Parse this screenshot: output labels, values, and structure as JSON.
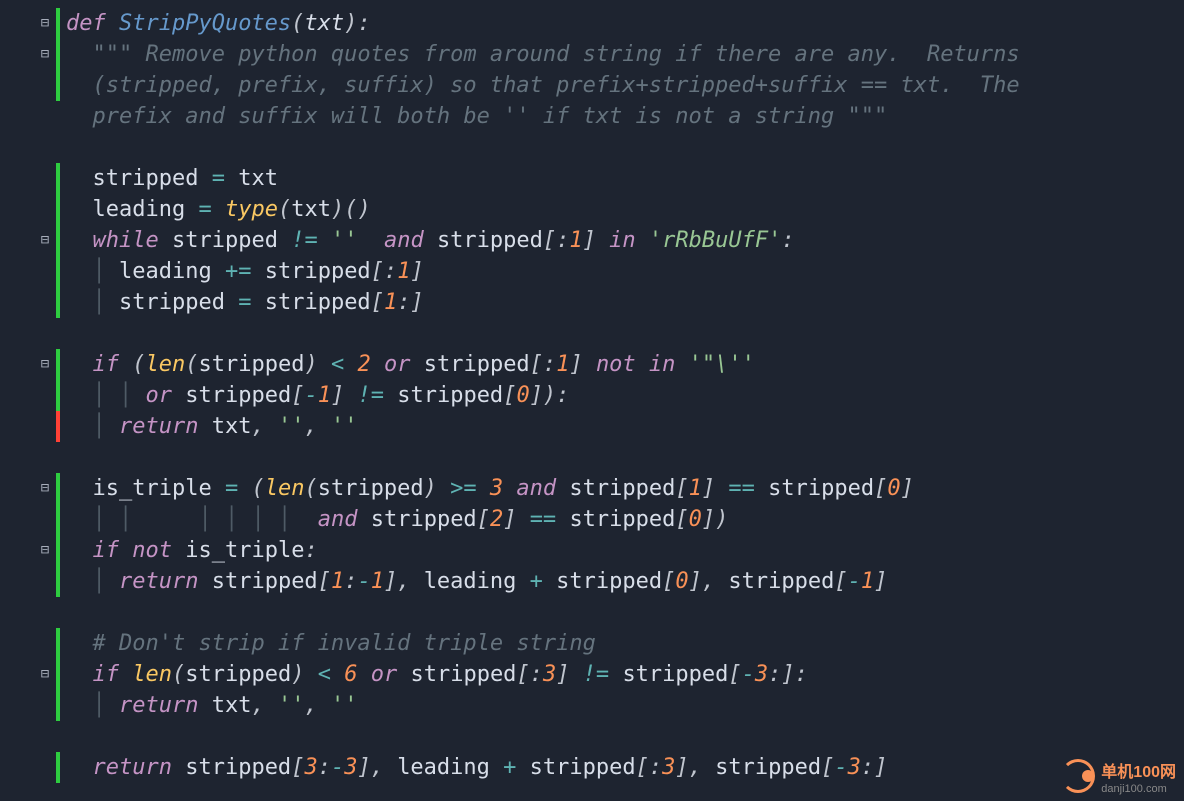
{
  "lines": [
    {
      "indent": 0,
      "type": "code",
      "tokens": [
        {
          "c": "kw",
          "t": "def "
        },
        {
          "c": "fn",
          "t": "StripPyQuotes"
        },
        {
          "c": "punct",
          "t": "("
        },
        {
          "c": "param",
          "t": "txt"
        },
        {
          "c": "punct",
          "t": "):"
        }
      ],
      "fold": true,
      "diff": "green",
      "diffH": 1
    },
    {
      "indent": 1,
      "type": "code",
      "tokens": [
        {
          "c": "docstr",
          "t": "\"\"\" Remove python quotes from around string if there are any.  Returns"
        }
      ],
      "fold": true,
      "diff": "green",
      "diffH": 2
    },
    {
      "indent": 1,
      "type": "code",
      "tokens": [
        {
          "c": "docstr",
          "t": "(stripped, prefix, suffix) so that prefix+stripped+suffix == txt.  The"
        }
      ]
    },
    {
      "indent": 1,
      "type": "code",
      "tokens": [
        {
          "c": "docstr",
          "t": "prefix and suffix will both be '' if txt is not a string \"\"\""
        }
      ]
    },
    {
      "indent": 0,
      "type": "blank"
    },
    {
      "indent": 1,
      "type": "code",
      "tokens": [
        {
          "c": "ident",
          "t": "stripped "
        },
        {
          "c": "op",
          "t": "= "
        },
        {
          "c": "ident",
          "t": "txt"
        }
      ],
      "diff": "green",
      "diffH": 5
    },
    {
      "indent": 1,
      "type": "code",
      "tokens": [
        {
          "c": "ident",
          "t": "leading "
        },
        {
          "c": "op",
          "t": "= "
        },
        {
          "c": "builtin",
          "t": "type"
        },
        {
          "c": "punct",
          "t": "("
        },
        {
          "c": "ident",
          "t": "txt"
        },
        {
          "c": "punct",
          "t": ")()"
        }
      ]
    },
    {
      "indent": 1,
      "type": "code",
      "tokens": [
        {
          "c": "kw",
          "t": "while "
        },
        {
          "c": "ident",
          "t": "stripped "
        },
        {
          "c": "op",
          "t": "!= "
        },
        {
          "c": "str",
          "t": "''"
        },
        {
          "c": "ident",
          "t": " "
        },
        {
          "c": "kw",
          "t": " and "
        },
        {
          "c": "ident",
          "t": "stripped"
        },
        {
          "c": "punct",
          "t": "[:"
        },
        {
          "c": "num",
          "t": "1"
        },
        {
          "c": "punct",
          "t": "]"
        },
        {
          "c": "ident",
          "t": " "
        },
        {
          "c": "kw",
          "t": "in "
        },
        {
          "c": "str",
          "t": "'rRbBuUfF'"
        },
        {
          "c": "punct",
          "t": ":"
        }
      ],
      "fold": true
    },
    {
      "indent": 2,
      "type": "code",
      "tokens": [
        {
          "c": "ident",
          "t": "leading "
        },
        {
          "c": "op",
          "t": "+= "
        },
        {
          "c": "ident",
          "t": "stripped"
        },
        {
          "c": "punct",
          "t": "[:"
        },
        {
          "c": "num",
          "t": "1"
        },
        {
          "c": "punct",
          "t": "]"
        }
      ]
    },
    {
      "indent": 2,
      "type": "code",
      "tokens": [
        {
          "c": "ident",
          "t": "stripped "
        },
        {
          "c": "op",
          "t": "= "
        },
        {
          "c": "ident",
          "t": "stripped"
        },
        {
          "c": "punct",
          "t": "["
        },
        {
          "c": "num",
          "t": "1"
        },
        {
          "c": "punct",
          "t": ":]"
        }
      ]
    },
    {
      "indent": 0,
      "type": "blank"
    },
    {
      "indent": 1,
      "type": "code",
      "tokens": [
        {
          "c": "kw",
          "t": "if "
        },
        {
          "c": "punct",
          "t": "("
        },
        {
          "c": "builtin",
          "t": "len"
        },
        {
          "c": "punct",
          "t": "("
        },
        {
          "c": "ident",
          "t": "stripped"
        },
        {
          "c": "punct",
          "t": ") "
        },
        {
          "c": "op",
          "t": "< "
        },
        {
          "c": "num",
          "t": "2"
        },
        {
          "c": "ident",
          "t": " "
        },
        {
          "c": "kw",
          "t": "or "
        },
        {
          "c": "ident",
          "t": "stripped"
        },
        {
          "c": "punct",
          "t": "[:"
        },
        {
          "c": "num",
          "t": "1"
        },
        {
          "c": "punct",
          "t": "]"
        },
        {
          "c": "ident",
          "t": " "
        },
        {
          "c": "kw",
          "t": "not in "
        },
        {
          "c": "str",
          "t": "'\"\\''"
        }
      ],
      "fold": true,
      "diff": "green",
      "diffH": 2
    },
    {
      "indent": 3,
      "type": "code",
      "tokens": [
        {
          "c": "kw",
          "t": "or "
        },
        {
          "c": "ident",
          "t": "stripped"
        },
        {
          "c": "punct",
          "t": "["
        },
        {
          "c": "op",
          "t": "-"
        },
        {
          "c": "num",
          "t": "1"
        },
        {
          "c": "punct",
          "t": "] "
        },
        {
          "c": "op",
          "t": "!= "
        },
        {
          "c": "ident",
          "t": "stripped"
        },
        {
          "c": "punct",
          "t": "["
        },
        {
          "c": "num",
          "t": "0"
        },
        {
          "c": "punct",
          "t": "]):"
        }
      ]
    },
    {
      "indent": 2,
      "type": "code",
      "tokens": [
        {
          "c": "kw",
          "t": "return "
        },
        {
          "c": "ident",
          "t": "txt"
        },
        {
          "c": "punct",
          "t": ", "
        },
        {
          "c": "str",
          "t": "''"
        },
        {
          "c": "punct",
          "t": ", "
        },
        {
          "c": "str",
          "t": "''"
        }
      ],
      "diff": "red",
      "diffH": 1
    },
    {
      "indent": 0,
      "type": "blank"
    },
    {
      "indent": 1,
      "type": "code",
      "tokens": [
        {
          "c": "ident",
          "t": "is_triple "
        },
        {
          "c": "op",
          "t": "= "
        },
        {
          "c": "punct",
          "t": "("
        },
        {
          "c": "builtin",
          "t": "len"
        },
        {
          "c": "punct",
          "t": "("
        },
        {
          "c": "ident",
          "t": "stripped"
        },
        {
          "c": "punct",
          "t": ") "
        },
        {
          "c": "op",
          "t": ">= "
        },
        {
          "c": "num",
          "t": "3"
        },
        {
          "c": "ident",
          "t": " "
        },
        {
          "c": "kw",
          "t": "and "
        },
        {
          "c": "ident",
          "t": "stripped"
        },
        {
          "c": "punct",
          "t": "["
        },
        {
          "c": "num",
          "t": "1"
        },
        {
          "c": "punct",
          "t": "] "
        },
        {
          "c": "op",
          "t": "== "
        },
        {
          "c": "ident",
          "t": "stripped"
        },
        {
          "c": "punct",
          "t": "["
        },
        {
          "c": "num",
          "t": "0"
        },
        {
          "c": "punct",
          "t": "]"
        }
      ],
      "fold": true,
      "diff": "green",
      "diffH": 4
    },
    {
      "indent": 6,
      "type": "code",
      "tokens": [
        {
          "c": "ident",
          "t": " "
        },
        {
          "c": "kw",
          "t": "and "
        },
        {
          "c": "ident",
          "t": "stripped"
        },
        {
          "c": "punct",
          "t": "["
        },
        {
          "c": "num",
          "t": "2"
        },
        {
          "c": "punct",
          "t": "] "
        },
        {
          "c": "op",
          "t": "== "
        },
        {
          "c": "ident",
          "t": "stripped"
        },
        {
          "c": "punct",
          "t": "["
        },
        {
          "c": "num",
          "t": "0"
        },
        {
          "c": "punct",
          "t": "])"
        }
      ]
    },
    {
      "indent": 1,
      "type": "code",
      "tokens": [
        {
          "c": "kw",
          "t": "if "
        },
        {
          "c": "kw",
          "t": "not "
        },
        {
          "c": "ident",
          "t": "is_triple"
        },
        {
          "c": "punct",
          "t": ":"
        }
      ],
      "fold": true
    },
    {
      "indent": 2,
      "type": "code",
      "tokens": [
        {
          "c": "kw",
          "t": "return "
        },
        {
          "c": "ident",
          "t": "stripped"
        },
        {
          "c": "punct",
          "t": "["
        },
        {
          "c": "num",
          "t": "1"
        },
        {
          "c": "punct",
          "t": ":"
        },
        {
          "c": "op",
          "t": "-"
        },
        {
          "c": "num",
          "t": "1"
        },
        {
          "c": "punct",
          "t": "], "
        },
        {
          "c": "ident",
          "t": "leading "
        },
        {
          "c": "op",
          "t": "+ "
        },
        {
          "c": "ident",
          "t": "stripped"
        },
        {
          "c": "punct",
          "t": "["
        },
        {
          "c": "num",
          "t": "0"
        },
        {
          "c": "punct",
          "t": "], "
        },
        {
          "c": "ident",
          "t": "stripped"
        },
        {
          "c": "punct",
          "t": "["
        },
        {
          "c": "op",
          "t": "-"
        },
        {
          "c": "num",
          "t": "1"
        },
        {
          "c": "punct",
          "t": "]"
        }
      ]
    },
    {
      "indent": 0,
      "type": "blank"
    },
    {
      "indent": 1,
      "type": "code",
      "tokens": [
        {
          "c": "comment",
          "t": "# Don't strip if invalid triple string"
        }
      ],
      "diff": "green",
      "diffH": 3
    },
    {
      "indent": 1,
      "type": "code",
      "tokens": [
        {
          "c": "kw",
          "t": "if "
        },
        {
          "c": "builtin",
          "t": "len"
        },
        {
          "c": "punct",
          "t": "("
        },
        {
          "c": "ident",
          "t": "stripped"
        },
        {
          "c": "punct",
          "t": ") "
        },
        {
          "c": "op",
          "t": "< "
        },
        {
          "c": "num",
          "t": "6"
        },
        {
          "c": "ident",
          "t": " "
        },
        {
          "c": "kw",
          "t": "or "
        },
        {
          "c": "ident",
          "t": "stripped"
        },
        {
          "c": "punct",
          "t": "[:"
        },
        {
          "c": "num",
          "t": "3"
        },
        {
          "c": "punct",
          "t": "] "
        },
        {
          "c": "op",
          "t": "!= "
        },
        {
          "c": "ident",
          "t": "stripped"
        },
        {
          "c": "punct",
          "t": "["
        },
        {
          "c": "op",
          "t": "-"
        },
        {
          "c": "num",
          "t": "3"
        },
        {
          "c": "punct",
          "t": ":]:"
        }
      ],
      "fold": true
    },
    {
      "indent": 2,
      "type": "code",
      "tokens": [
        {
          "c": "kw",
          "t": "return "
        },
        {
          "c": "ident",
          "t": "txt"
        },
        {
          "c": "punct",
          "t": ", "
        },
        {
          "c": "str",
          "t": "''"
        },
        {
          "c": "punct",
          "t": ", "
        },
        {
          "c": "str",
          "t": "''"
        }
      ]
    },
    {
      "indent": 0,
      "type": "blank"
    },
    {
      "indent": 1,
      "type": "code",
      "tokens": [
        {
          "c": "kw",
          "t": "return "
        },
        {
          "c": "ident",
          "t": "stripped"
        },
        {
          "c": "punct",
          "t": "["
        },
        {
          "c": "num",
          "t": "3"
        },
        {
          "c": "punct",
          "t": ":"
        },
        {
          "c": "op",
          "t": "-"
        },
        {
          "c": "num",
          "t": "3"
        },
        {
          "c": "punct",
          "t": "], "
        },
        {
          "c": "ident",
          "t": "leading "
        },
        {
          "c": "op",
          "t": "+ "
        },
        {
          "c": "ident",
          "t": "stripped"
        },
        {
          "c": "punct",
          "t": "[:"
        },
        {
          "c": "num",
          "t": "3"
        },
        {
          "c": "punct",
          "t": "], "
        },
        {
          "c": "ident",
          "t": "stripped"
        },
        {
          "c": "punct",
          "t": "["
        },
        {
          "c": "op",
          "t": "-"
        },
        {
          "c": "num",
          "t": "3"
        },
        {
          "c": "punct",
          "t": ":]"
        }
      ],
      "diff": "green",
      "diffH": 1
    }
  ],
  "watermark": {
    "brand": "单机100网",
    "url": "danji100.com"
  },
  "foldGlyph": "⊟",
  "guideGlyph": "│"
}
